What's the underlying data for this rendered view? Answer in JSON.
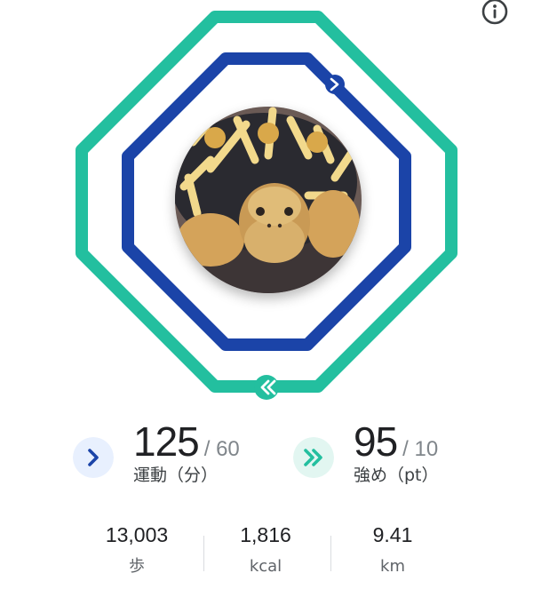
{
  "colors": {
    "heart_points": "#23bf9f",
    "move_minutes": "#1b44a8",
    "text_primary": "#202124",
    "text_secondary": "#80868b"
  },
  "header": {
    "info_icon": "info-icon"
  },
  "rings": {
    "outer_icon": "double-chevron-icon",
    "inner_icon": "chevron-right-icon",
    "center_image": "tortoise-photo"
  },
  "move_minutes": {
    "value": "125",
    "goal": "/ 60",
    "label": "運動（分）",
    "icon": "chevron-right-icon"
  },
  "heart_points": {
    "value": "95",
    "goal": "/ 10",
    "label": "強め（pt）",
    "icon": "double-chevron-icon"
  },
  "metrics": [
    {
      "value": "13,003",
      "label": "歩"
    },
    {
      "value": "1,816",
      "label": "kcal"
    },
    {
      "value": "9.41",
      "label": "km"
    }
  ]
}
